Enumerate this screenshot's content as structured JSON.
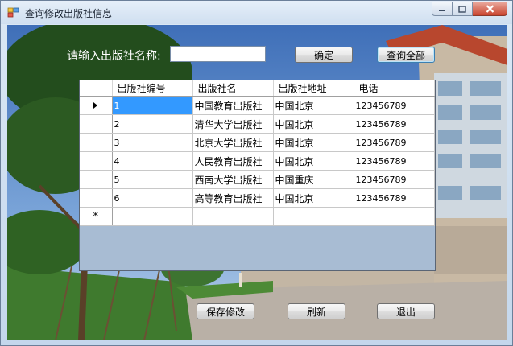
{
  "window": {
    "title": "查询修改出版社信息",
    "icons": {
      "app": "app-icon",
      "minimize": "minimize-icon",
      "maximize": "maximize-icon",
      "close": "close-icon"
    }
  },
  "search": {
    "label": "请输入出版社名称:",
    "value": "",
    "placeholder": "",
    "confirm_label": "确定",
    "query_all_label": "查询全部"
  },
  "grid": {
    "columns": [
      "出版社编号",
      "出版社名",
      "出版社地址",
      "电话"
    ],
    "rows": [
      {
        "id": "1",
        "name": "中国教育出版社",
        "address": "中国北京",
        "phone": "123456789"
      },
      {
        "id": "2",
        "name": "清华大学出版社",
        "address": "中国北京",
        "phone": "123456789"
      },
      {
        "id": "3",
        "name": "北京大学出版社",
        "address": "中国北京",
        "phone": "123456789"
      },
      {
        "id": "4",
        "name": "人民教育出版社",
        "address": "中国北京",
        "phone": "123456789"
      },
      {
        "id": "5",
        "name": "西南大学出版社",
        "address": "中国重庆",
        "phone": "123456789"
      },
      {
        "id": "6",
        "name": "高等教育出版社",
        "address": "中国北京",
        "phone": "123456789"
      }
    ],
    "new_row_marker": "*",
    "selected_cell_color": "#3399ff",
    "current_row_icon": "current-row-arrow-icon"
  },
  "actions": {
    "save_label": "保存修改",
    "refresh_label": "刷新",
    "exit_label": "退出"
  },
  "colors": {
    "grid_background": "#a8bcd3",
    "close_button": "#c9452f"
  }
}
